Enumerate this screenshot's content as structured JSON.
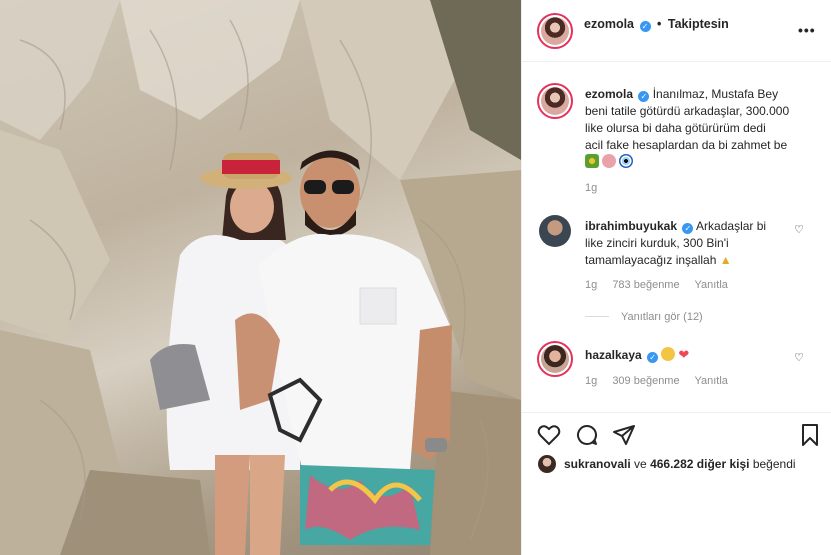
{
  "post": {
    "author": "ezomola",
    "verified_mark": "✓",
    "separator": "•",
    "follow_status": "Takiptesin",
    "more_label": "•••",
    "caption_user": "ezomola",
    "caption_line1": "İnanılmaz, Mustafa Bey",
    "caption_line2": "beni tatile götürdü arkadaşlar, 300.000",
    "caption_line3": "like olursa bi daha götürürüm dedi",
    "caption_line4": "acil fake hesaplardan da bi zahmet be",
    "caption_time": "1g"
  },
  "comments": [
    {
      "user": "ibrahimbuyukak",
      "text_line1": "Arkadaşlar bi",
      "text_line2": "like zinciri kurduk, 300 Bin'i",
      "text_line3": "tamamlayacağız inşallah",
      "time": "1g",
      "likes": "783 beğenme",
      "reply": "Yanıtla",
      "view_replies": "Yanıtları gör (12)"
    },
    {
      "user": "hazalkaya",
      "time": "1g",
      "likes": "309 beğenme",
      "reply": "Yanıtla"
    }
  ],
  "icons": {
    "like": "heart-icon",
    "comment": "comment-icon",
    "share": "share-icon",
    "save": "bookmark-icon"
  },
  "liked_by": {
    "user": "sukranovali",
    "connector": "ve",
    "others": "466.282 diğer kişi",
    "suffix": "beğendi"
  },
  "colors": {
    "verified": "#3897f0",
    "story_ring": "#e3325d",
    "muted": "#8e8e8e",
    "heart_red": "#ed4956"
  }
}
